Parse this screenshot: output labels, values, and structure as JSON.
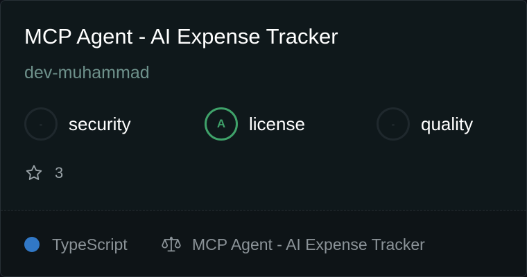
{
  "card": {
    "title": "MCP Agent - AI Expense Tracker",
    "owner": "dev-muhammad"
  },
  "badges": [
    {
      "grade": "-",
      "label": "security",
      "status": "none"
    },
    {
      "grade": "A",
      "label": "license",
      "status": "pass"
    },
    {
      "grade": "-",
      "label": "quality",
      "status": "none"
    }
  ],
  "stars": {
    "icon": "star-outline-icon",
    "count": "3"
  },
  "footer": {
    "language": "TypeScript",
    "language_color": "#3178c6",
    "license_icon": "scale-icon",
    "license": "MCP Agent - AI Expense Tracker"
  },
  "colors": {
    "background": "#0f181b",
    "owner_text": "#6e918b",
    "pass_green": "#3fa26a"
  }
}
